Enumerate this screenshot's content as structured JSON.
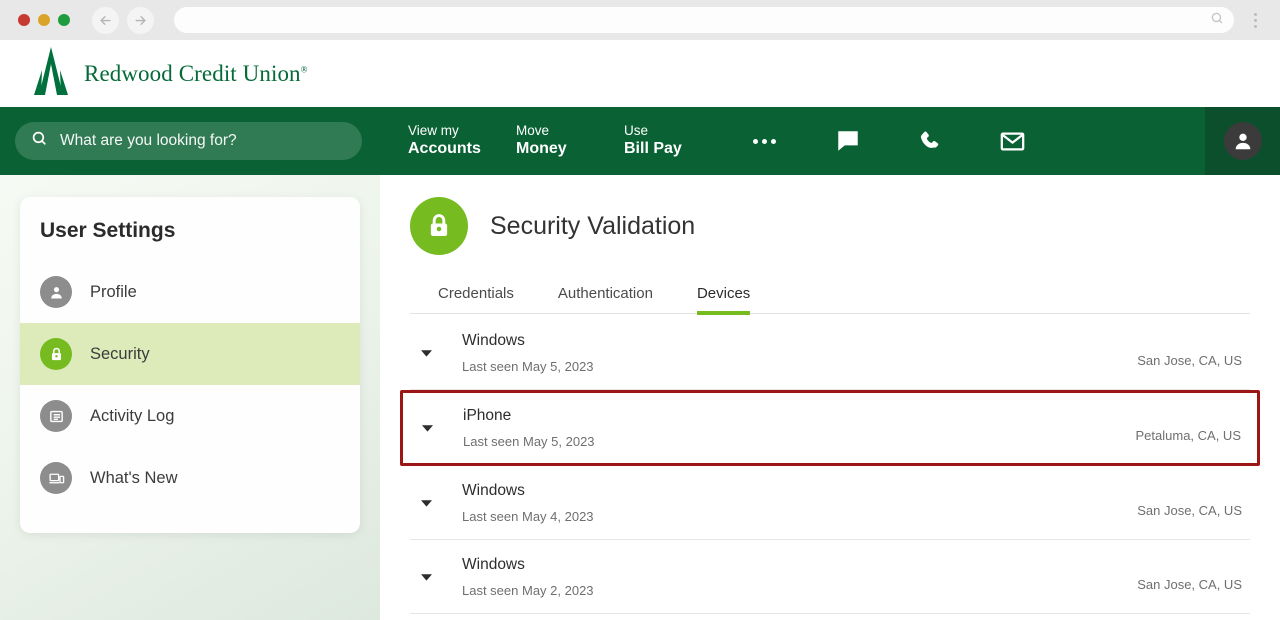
{
  "browser": {
    "back_icon": "arrow-left-icon",
    "forward_icon": "arrow-right-icon",
    "url_value": "",
    "url_search_icon": "search-icon",
    "menu_icon": "kebab-menu-icon"
  },
  "brand": {
    "name": "Redwood Credit Union",
    "trademark": "®",
    "logo_icon": "redwood-tree-logo",
    "green": "#046a38"
  },
  "nav": {
    "search": {
      "placeholder": "What are you looking for?",
      "value": "",
      "icon": "search-icon"
    },
    "items": [
      {
        "top": "View my",
        "bottom": "Accounts"
      },
      {
        "top": "Move",
        "bottom": "Money"
      },
      {
        "top": "Use",
        "bottom": "Bill Pay"
      }
    ],
    "more_icon": "ellipsis-icon",
    "icons": [
      {
        "name": "chat-icon"
      },
      {
        "name": "phone-icon"
      },
      {
        "name": "envelope-icon"
      }
    ],
    "avatar_icon": "user-avatar-icon",
    "bar_color": "#0a6234",
    "avatar_cell_color": "#0c4f2d"
  },
  "sidebar": {
    "title": "User Settings",
    "items": [
      {
        "label": "Profile",
        "icon": "user-icon",
        "active": false
      },
      {
        "label": "Security",
        "icon": "lock-icon",
        "active": true
      },
      {
        "label": "Activity Log",
        "icon": "list-icon",
        "active": false
      },
      {
        "label": "What's New",
        "icon": "devices-icon",
        "active": false
      }
    ],
    "active_bg": "#dcebb9"
  },
  "main": {
    "title": "Security Validation",
    "title_icon": "lock-icon",
    "accent_green": "#76bc21",
    "tabs": [
      {
        "label": "Credentials",
        "active": false
      },
      {
        "label": "Authentication",
        "active": false
      },
      {
        "label": "Devices",
        "active": true
      }
    ],
    "devices": [
      {
        "name": "Windows",
        "last_seen": "Last seen May 5, 2023",
        "location": "San Jose, CA, US",
        "highlighted": false,
        "caret_icon": "chevron-down-icon"
      },
      {
        "name": "iPhone",
        "last_seen": "Last seen May 5, 2023",
        "location": "Petaluma, CA, US",
        "highlighted": true,
        "caret_icon": "chevron-down-icon"
      },
      {
        "name": "Windows",
        "last_seen": "Last seen May 4, 2023",
        "location": "San Jose, CA, US",
        "highlighted": false,
        "caret_icon": "chevron-down-icon"
      },
      {
        "name": "Windows",
        "last_seen": "Last seen May 2, 2023",
        "location": "San Jose, CA, US",
        "highlighted": false,
        "caret_icon": "chevron-down-icon"
      }
    ],
    "highlight_color": "#9c1616"
  }
}
